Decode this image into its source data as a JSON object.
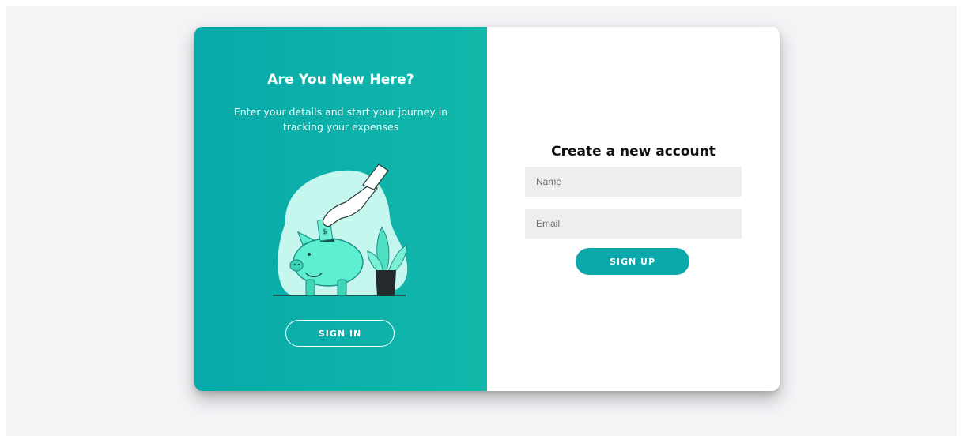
{
  "left": {
    "title": "Are You New Here?",
    "subtitle": "Enter your details and start your journey in tracking your expenses",
    "illustration": "piggy-bank-savings-illustration",
    "signin_label": "SIGN IN"
  },
  "right": {
    "title": "Create a new account",
    "name_placeholder": "Name",
    "name_value": "",
    "email_placeholder": "Email",
    "email_value": "",
    "signup_label": "SIGN UP"
  },
  "colors": {
    "accent": "#0aa7ab",
    "gradient_start": "#08a9a9",
    "gradient_end": "#12b8aa",
    "field_bg": "#eeeeee",
    "page_bg": "#f4f4f7"
  }
}
